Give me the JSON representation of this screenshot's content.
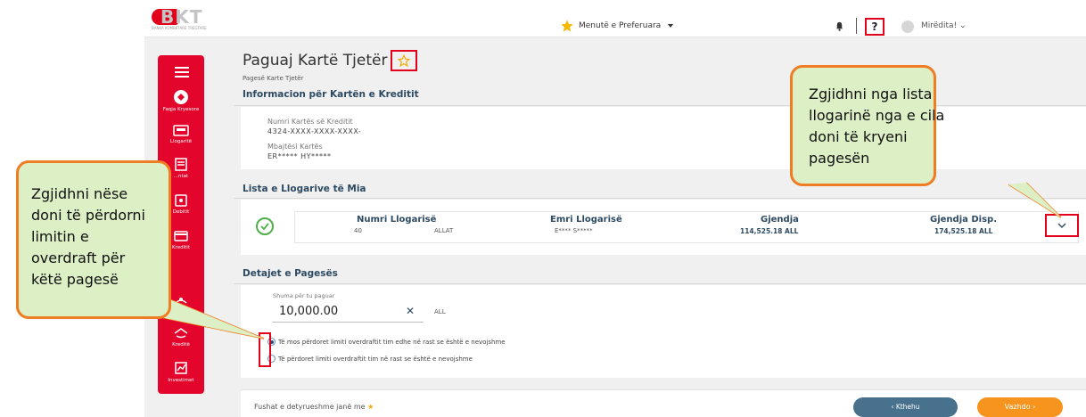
{
  "header": {
    "logo_letters": "BKT",
    "logo_subtitle": "BANKA KOMBETARE TREGTARE",
    "favorites_menu": "Menutë e Preferuara",
    "help": "?",
    "greeting": "Mirëdita!",
    "greeting_caret": "⌄"
  },
  "sidebar": {
    "items": [
      {
        "label": "Faqja Kryesore",
        "icon": "home-icon"
      },
      {
        "label": "Llogaritë",
        "icon": "accounts-icon"
      },
      {
        "label": "...ntat",
        "icon": "payments-icon"
      },
      {
        "label": "Debitit",
        "icon": "debit-card-icon"
      },
      {
        "label": "Kreditit",
        "icon": "credit-card-icon"
      },
      {
        "label": "Pagesat",
        "icon": "payments-hand-icon"
      },
      {
        "label": "Kreditë",
        "icon": "loans-icon"
      },
      {
        "label": "Investimet",
        "icon": "investments-icon"
      }
    ]
  },
  "page": {
    "title": "Paguaj Kartë Tjetër",
    "subtitle": "Pagesë Karte Tjetër"
  },
  "credit_info": {
    "section_title": "Informacion për Kartën e Kreditit",
    "card_number_label": "Numri Kartës së Kreditit",
    "card_number_value": "4324-XXXX-XXXX-XXXX-",
    "holder_label": "Mbajtësi Kartës",
    "holder_value": "ER***** HY*****"
  },
  "accounts": {
    "section_title": "Lista e Llogarive të Mia",
    "columns": [
      "Numri Llogarisë",
      "Emri Llogarisë",
      "Gjendja",
      "Gjendja Disp."
    ],
    "row": {
      "number_part1": "40",
      "number_part2": "ALLAT",
      "name": "E****   S*****",
      "balance": "114,525.18 ALL",
      "available": "174,525.18 ALL"
    }
  },
  "payment": {
    "section_title": "Detajet e Pagesës",
    "amount_label": "Shuma për tu paguar",
    "amount_value": "10,000.00",
    "clear": "✕",
    "currency": "ALL",
    "option_no_overdraft": "Të mos përdoret limiti overdraftit tim edhe në rast se është e nevojshme",
    "option_overdraft": "Të përdoret limiti overdraftit tim në rast se është e nevojshme",
    "selected_option": "option_no_overdraft"
  },
  "footer": {
    "required_note": "Fushat e detyrueshme janë me",
    "back_button": "‹ Kthehu",
    "next_button": "Vazhdo ›"
  },
  "callouts": {
    "right_lines": [
      "Zgjidhni nga lista",
      "llogarinë nga e cila",
      "doni të kryeni",
      "pagesën"
    ],
    "left_lines": [
      "Zgjidhni nëse",
      "doni të përdorni",
      "limitin e",
      "overdraft për",
      "këtë pagesë"
    ]
  },
  "colors": {
    "brand_red": "#e3052b",
    "callout_fill": "#dcefc5",
    "callout_border": "#ee7d23",
    "back_button": "#48718e",
    "next_button": "#f7941d",
    "heading_blue": "#2d4a63"
  }
}
